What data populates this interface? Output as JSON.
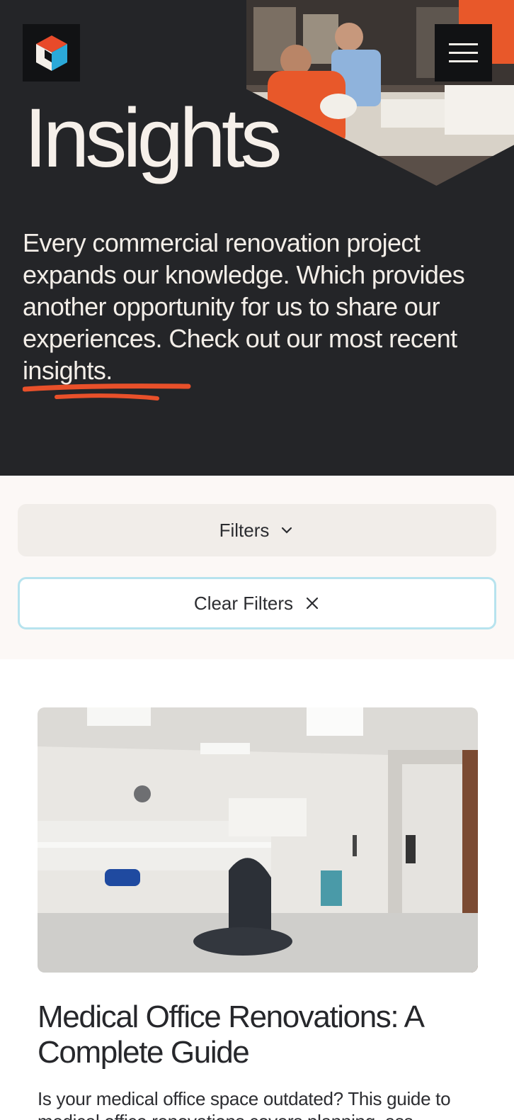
{
  "header": {
    "logo_name": "company-logo",
    "menu_icon": "hamburger-menu-icon"
  },
  "hero": {
    "title": "Insights",
    "intro": "Every commercial renovation project expands our knowledge. Which provides another opportunity for us to share our experiences. Check out our most",
    "highlight": "recent insights",
    "intro_end": "."
  },
  "filters": {
    "filters_label": "Filters",
    "filters_icon": "chevron-down-icon",
    "clear_label": "Clear Filters",
    "clear_icon": "close-icon"
  },
  "articles": [
    {
      "title": "Medical Office Renovations: A Complete Guide",
      "excerpt": "Is your medical office space outdated? This guide to medical office renovations covers planning, ass"
    }
  ],
  "colors": {
    "hero_bg": "#242528",
    "accent_orange": "#e8502a",
    "filter_bg": "#fcf8f6",
    "clear_border": "#b7e3ee"
  }
}
